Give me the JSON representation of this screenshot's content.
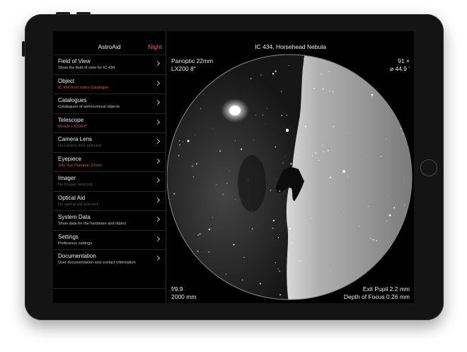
{
  "sidebar": {
    "title": "AstroAid",
    "night_label": "Night",
    "items": [
      {
        "title": "Field of View",
        "subtitle": "Show the field of view for IC 434",
        "subtitle_style": "white"
      },
      {
        "title": "Object",
        "subtitle": "IC 434 from Index Catalogue",
        "subtitle_style": "red"
      },
      {
        "title": "Catalogues",
        "subtitle": "Catalogues of astronomical objects",
        "subtitle_style": "white"
      },
      {
        "title": "Telescope",
        "subtitle": "Meade LX200 8\"",
        "subtitle_style": "red"
      },
      {
        "title": "Camera Lens",
        "subtitle": "No camera lens selected",
        "subtitle_style": "grey"
      },
      {
        "title": "Eyepiece",
        "subtitle": "Tele Vue Panoptic 22mm",
        "subtitle_style": "red"
      },
      {
        "title": "Imager",
        "subtitle": "No imager selected",
        "subtitle_style": "grey"
      },
      {
        "title": "Optical Aid",
        "subtitle": "No optical aid selected",
        "subtitle_style": "grey"
      },
      {
        "title": "System Data",
        "subtitle": "Show data for the hardware and object",
        "subtitle_style": "white"
      },
      {
        "title": "Settings",
        "subtitle": "Preference settings",
        "subtitle_style": "white"
      },
      {
        "title": "Documentation",
        "subtitle": "User documentation and contact information",
        "subtitle_style": "white"
      }
    ]
  },
  "main": {
    "title": "IC 434, Horsehead Nebula",
    "eyepiece": "Panoptic 22mm",
    "telescope": "LX200 8\"",
    "magnification": "91 ×",
    "field": "⌀ 44.9 '",
    "focal_ratio": "f/9.9",
    "focal_length": "2000 mm",
    "exit_pupil": "Exit Pupil 2.2 mm",
    "depth_of_focus": "Depth of Focus 0.26 mm"
  },
  "colors": {
    "accent_red": "#e06a6a",
    "battery_green": "#2fdc4a",
    "background": "#000000"
  }
}
